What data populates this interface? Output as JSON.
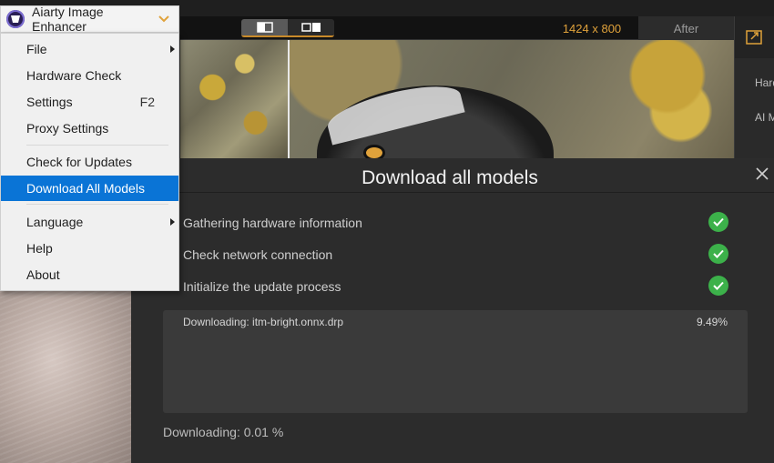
{
  "app": {
    "name": "Aiarty Image Enhancer",
    "accent_color": "#e0a23b"
  },
  "menu": {
    "items": [
      {
        "label": "File",
        "has_submenu": true
      },
      {
        "label": "Hardware Check"
      },
      {
        "label": "Settings",
        "shortcut": "F2"
      },
      {
        "label": "Proxy Settings"
      },
      {
        "label": "Check for Updates"
      },
      {
        "label": "Download All Models",
        "active": true
      },
      {
        "label": "Language",
        "has_submenu": true
      },
      {
        "label": "Help"
      },
      {
        "label": "About"
      }
    ]
  },
  "preview": {
    "resolution": "1424 x 800",
    "after_label": "After"
  },
  "right_panel": {
    "labels": [
      "Hard",
      "AI M"
    ]
  },
  "dialog": {
    "title": "Download all models",
    "steps": [
      {
        "label": "Gathering hardware information",
        "status": "done"
      },
      {
        "label": "Check network connection",
        "status": "done"
      },
      {
        "label": "Initialize the update process",
        "status": "done"
      }
    ],
    "current_file": "Downloading: itm-bright.onnx.drp",
    "current_percent": "9.49%",
    "total_progress": "Downloading: 0.01 %"
  }
}
